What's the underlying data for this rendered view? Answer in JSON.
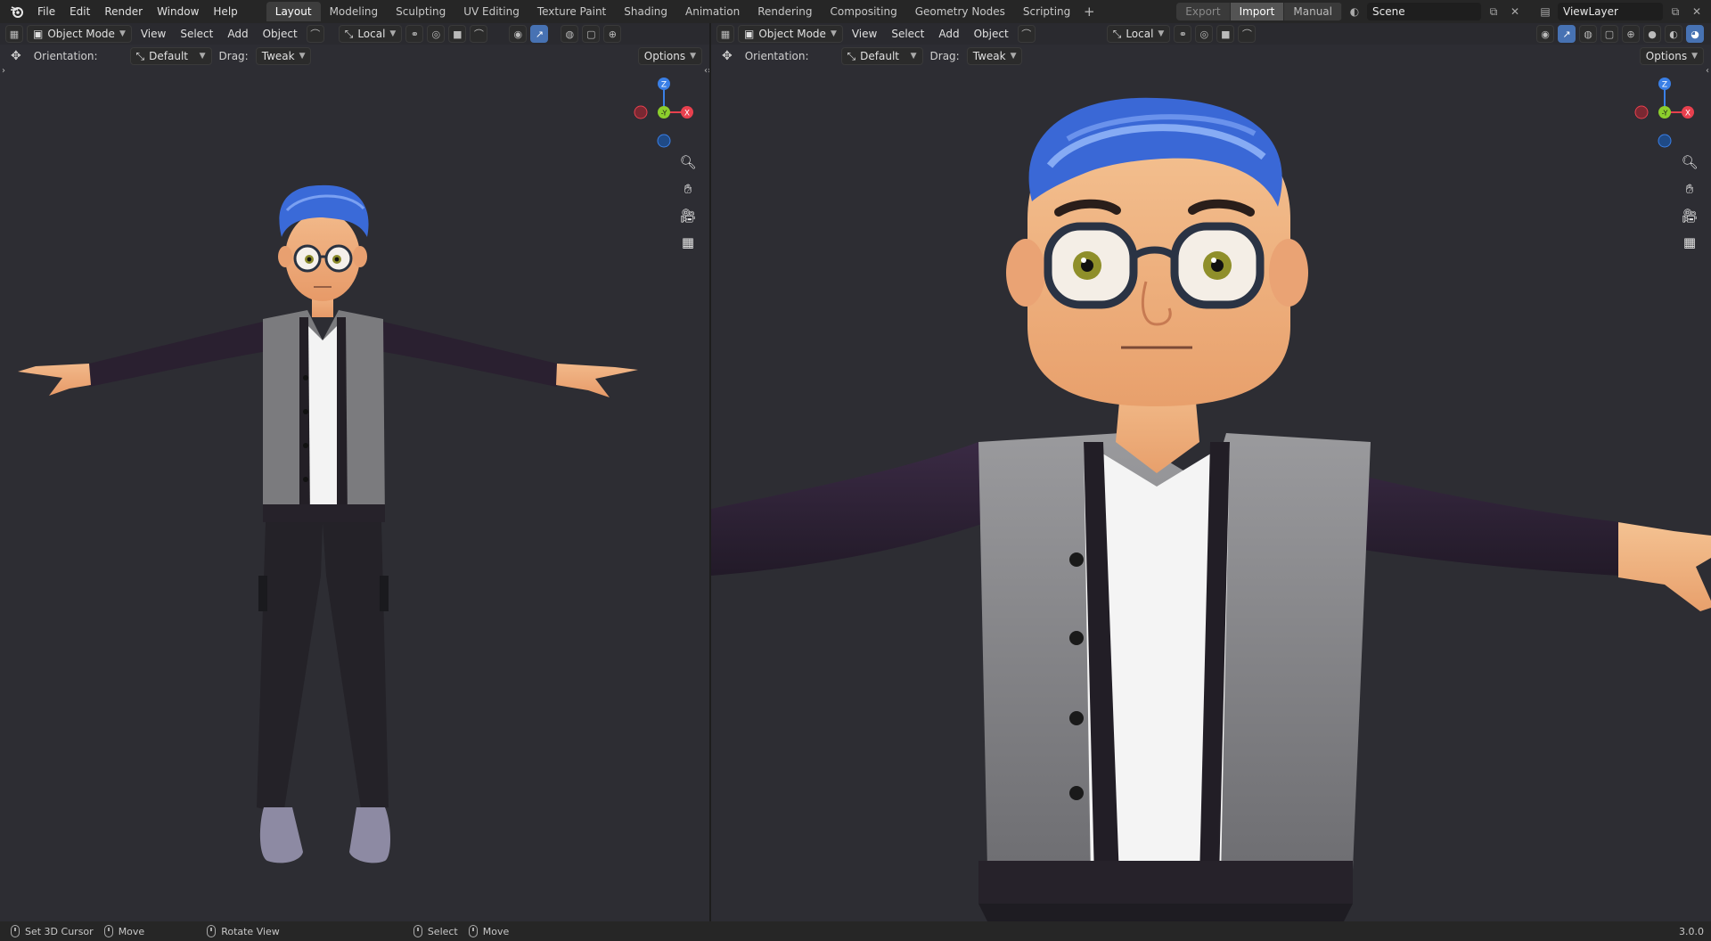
{
  "menu": [
    "File",
    "Edit",
    "Render",
    "Window",
    "Help"
  ],
  "workspaces": [
    {
      "label": "Layout",
      "active": true
    },
    {
      "label": "Modeling"
    },
    {
      "label": "Sculpting"
    },
    {
      "label": "UV Editing"
    },
    {
      "label": "Texture Paint"
    },
    {
      "label": "Shading"
    },
    {
      "label": "Animation"
    },
    {
      "label": "Rendering"
    },
    {
      "label": "Compositing"
    },
    {
      "label": "Geometry Nodes"
    },
    {
      "label": "Scripting"
    }
  ],
  "top_right": {
    "export": "Export",
    "import": "Import",
    "manual": "Manual",
    "scene": "Scene",
    "view_layer": "ViewLayer"
  },
  "viewport": {
    "mode": "Object Mode",
    "menus": [
      "View",
      "Select",
      "Add",
      "Object"
    ],
    "pivot": "Local",
    "orientation_label": "Orientation:",
    "orientation_value": "Default",
    "drag_label": "Drag:",
    "drag_value": "Tweak",
    "options": "Options"
  },
  "gizmo_axes": {
    "z": "Z",
    "y": "-Y",
    "x": "X"
  },
  "colors": {
    "viewport_bg": "#2d2d33",
    "accent": "#4772b3",
    "axis_x": "#e8404e",
    "axis_y": "#8ccf2c",
    "axis_z": "#3a7fe6"
  },
  "status": {
    "set_cursor": "Set 3D Cursor",
    "move1": "Move",
    "rotate_view": "Rotate View",
    "select": "Select",
    "move2": "Move",
    "version": "3.0.0"
  }
}
